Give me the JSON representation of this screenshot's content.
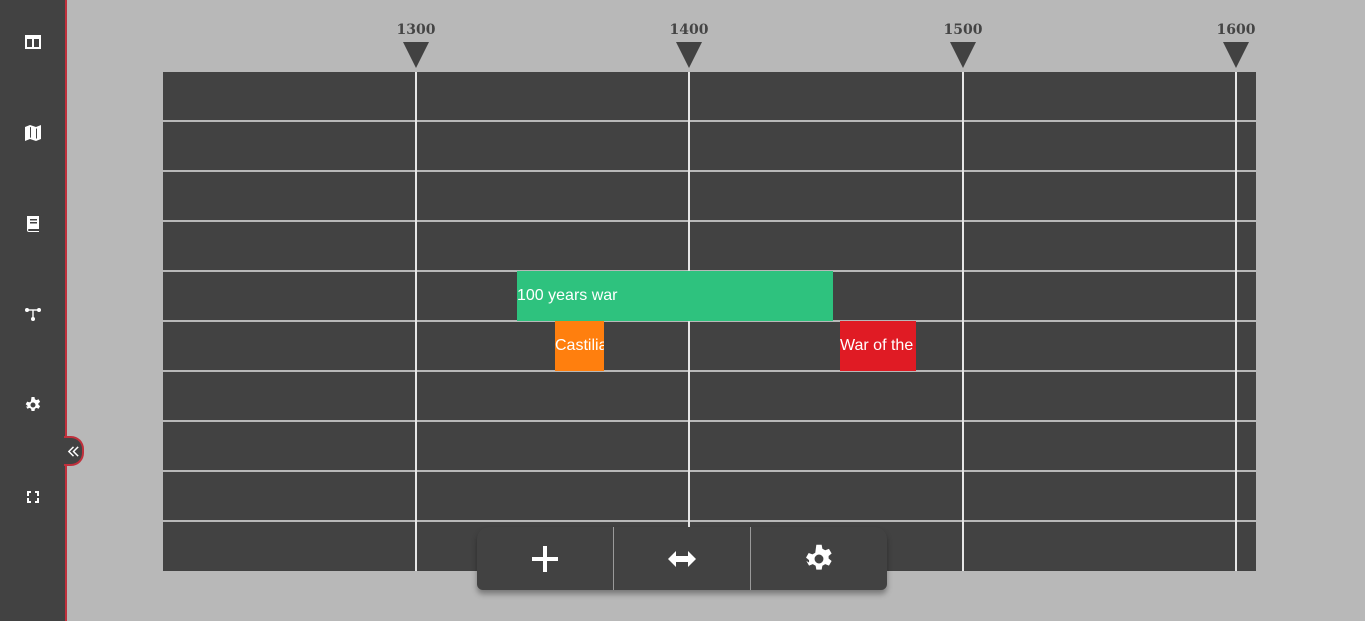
{
  "sidebar": {
    "buttons": [
      {
        "icon": "layout-icon"
      },
      {
        "icon": "map-icon"
      },
      {
        "icon": "book-icon"
      },
      {
        "icon": "graph-icon"
      },
      {
        "icon": "gear-icon"
      },
      {
        "icon": "refresh-icon"
      }
    ],
    "collapse_icon": "double-chevron-left-icon",
    "accent": "#c0303c"
  },
  "timeline": {
    "ticks": [
      "1300",
      "1400",
      "1500",
      "1600"
    ],
    "events": [
      {
        "label": "100 years war",
        "color": "#2ec27e"
      },
      {
        "label": "Castilian",
        "color": "#ff7f0e"
      },
      {
        "label": "War of the Roses",
        "color": "#e01b24"
      }
    ]
  },
  "toolbar": {
    "buttons": [
      {
        "icon": "plus-icon"
      },
      {
        "icon": "horizontal-arrows-icon"
      },
      {
        "icon": "gear-icon"
      }
    ]
  }
}
